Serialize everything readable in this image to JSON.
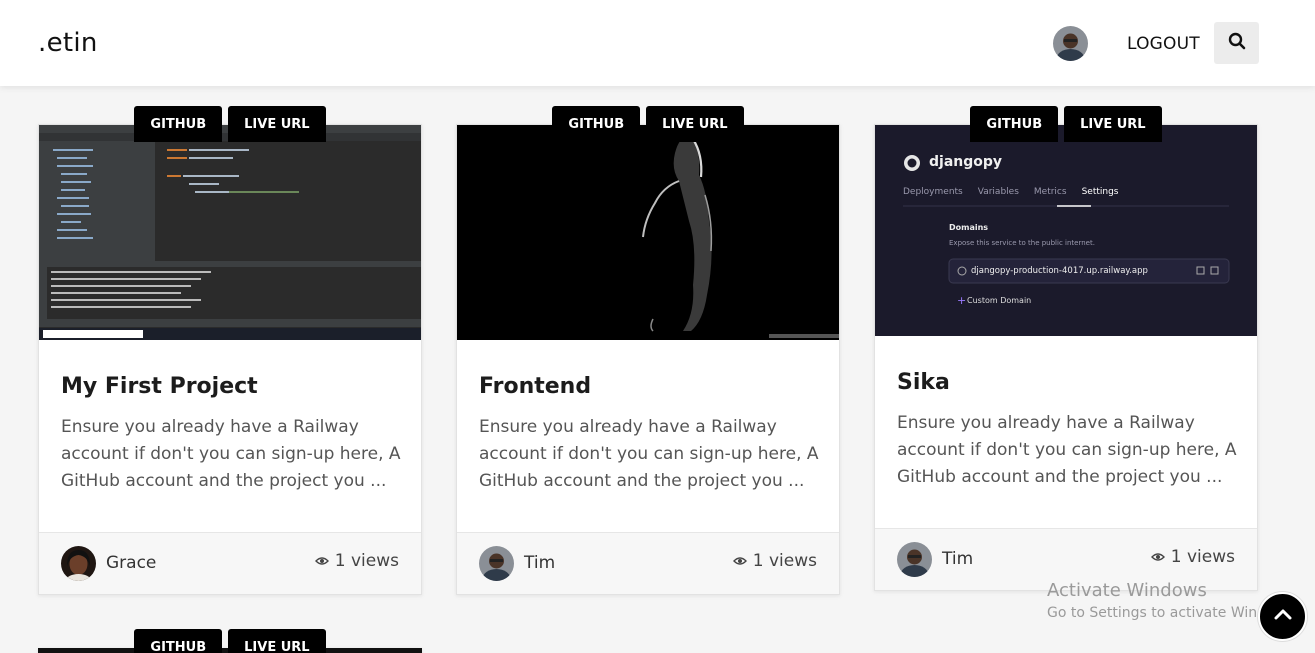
{
  "header": {
    "brand": ".etin",
    "logout_label": "LOGOUT",
    "search_icon": "search-icon"
  },
  "tags": {
    "github": "GITHUB",
    "live_url": "LIVE URL"
  },
  "cards": [
    {
      "title": "My First Project",
      "description": "Ensure you already have a Railway account if don't you can sign-up here, A GitHub account and the project you ...",
      "author": "Grace",
      "views": "1 views"
    },
    {
      "title": "Frontend",
      "description": "Ensure you already have a Railway account if don't you can sign-up here, A GitHub account and the project you ...",
      "author": "Tim",
      "views": "1 views"
    },
    {
      "title": "Sika",
      "description": "Ensure you already have a Railway account if don't you can sign-up here, A GitHub account and the project you ...",
      "author": "Tim",
      "views": "1 views"
    }
  ],
  "railway_shot": {
    "app_name": "djangopy",
    "tabs": [
      "Deployments",
      "Variables",
      "Metrics",
      "Settings"
    ],
    "section_title": "Domains",
    "section_desc": "Expose this service to the public internet.",
    "domain": "djangopy-production-4017.up.railway.app",
    "custom_domain": "Custom Domain"
  },
  "watermark": {
    "title": "Activate Windows",
    "subtitle": "Go to Settings to activate Windows."
  },
  "colors": {
    "accent": "#000000",
    "header_bg": "#ffffff",
    "page_bg": "#f5f5f5"
  }
}
